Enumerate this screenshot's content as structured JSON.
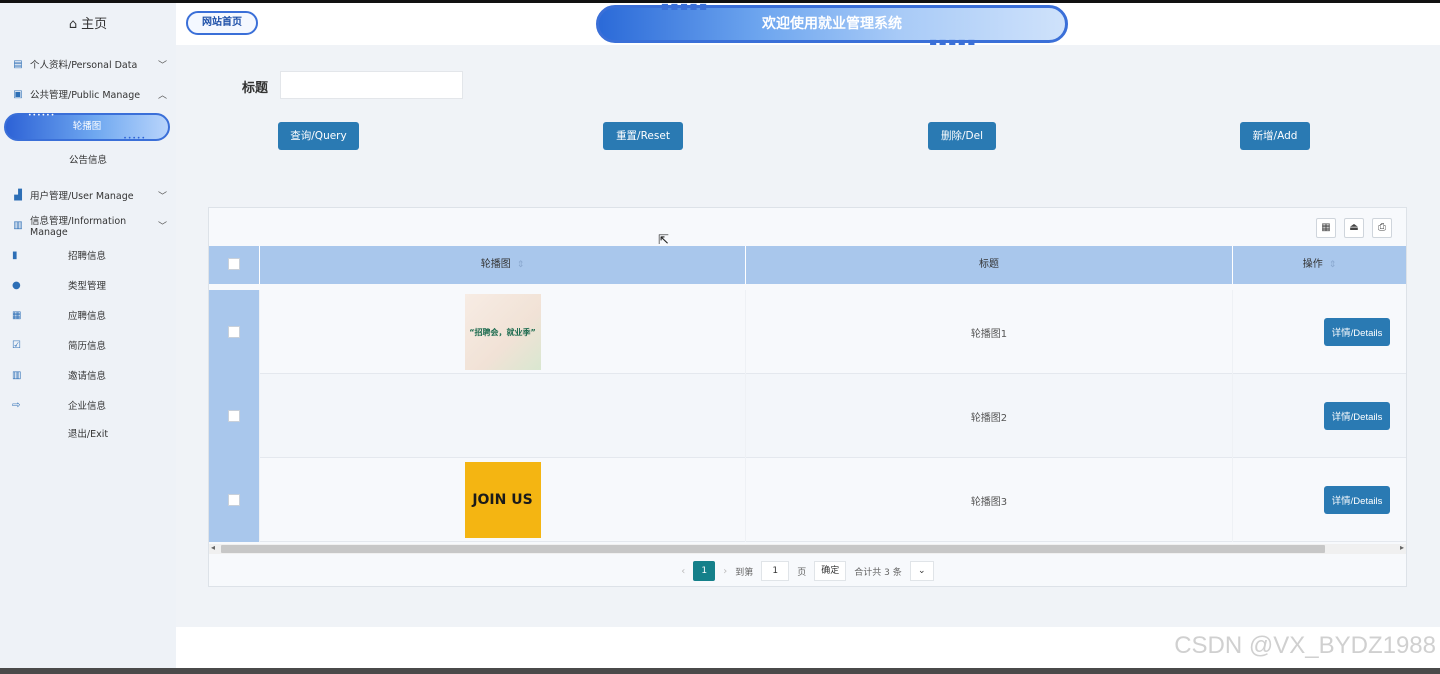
{
  "sidebar": {
    "home": "主页",
    "items": [
      {
        "label": "个人资料/Personal Data"
      },
      {
        "label": "公共管理/Public Manage"
      },
      {
        "label": "用户管理/User Manage"
      },
      {
        "label": "信息管理/Information Manage"
      }
    ],
    "active_sub": "轮播图",
    "notice": "公告信息",
    "info_subs": [
      "招聘信息",
      "类型管理",
      "应聘信息",
      "简历信息",
      "邀请信息",
      "企业信息"
    ],
    "exit": "退出/Exit"
  },
  "header": {
    "site_home": "网站首页",
    "banner_title": "欢迎使用就业管理系统"
  },
  "search": {
    "label": "标题",
    "value": ""
  },
  "buttons": {
    "query": "查询/Query",
    "reset": "重置/Reset",
    "delete": "删除/Del",
    "add": "新增/Add"
  },
  "table": {
    "columns": [
      "轮播图",
      "标题",
      "操作"
    ],
    "rows": [
      {
        "title": "轮播图1",
        "action": "详情/Details"
      },
      {
        "title": "轮播图2",
        "action": "详情/Details"
      },
      {
        "title": "轮播图3",
        "action": "详情/Details"
      }
    ],
    "thumb_text": [
      "“招聘会，就业季”",
      "",
      "JOIN US"
    ]
  },
  "pager": {
    "current": "1",
    "goto_label": "到第",
    "goto_value": "1",
    "page_label": "页",
    "confirm": "确定",
    "total": "合计共 3 条"
  },
  "watermark": "CSDN @VX_BYDZ1988",
  "colors": {
    "primary_button": "#2a7ab3",
    "header_row": "#a9c7ec",
    "active_page": "#15808a"
  }
}
